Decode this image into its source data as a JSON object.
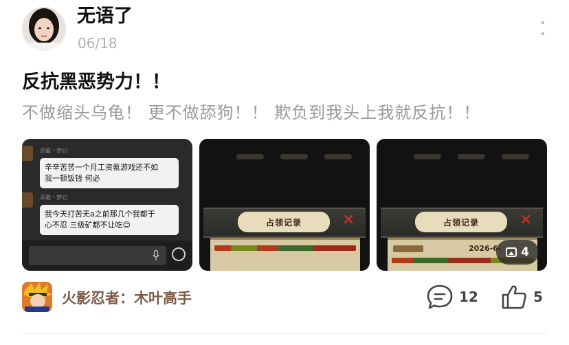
{
  "post": {
    "author": "无语了",
    "date": "06/18",
    "title": "反抗黑恶势力！！",
    "body": "不做缩头乌龟！ 更不做舔狗！！ 欺负到我头上我就反抗！！"
  },
  "images": {
    "chat": {
      "sender_name": "恶霸丶梦幻",
      "msg1_line1": "辛辛苦苦一个月工资氪游戏还不如",
      "msg1_line2": "我一顿饭钱 何必",
      "msg2_line1": "我今天打苦无a之前那几个我都于",
      "msg2_line2": "心不忍 三级矿都不让吃😊"
    },
    "game1": {
      "panel_title": "占领记录"
    },
    "game2": {
      "panel_title": "占领记录",
      "date_text": "2026-6-"
    },
    "more_count": "4"
  },
  "footer": {
    "game_tag": "火影忍者：木叶高手",
    "comment_count": "12",
    "like_count": "5"
  },
  "icons": [
    "more-icon",
    "photos-icon",
    "comment-icon",
    "like-icon",
    "mic-icon",
    "emoji-icon",
    "close-icon"
  ],
  "colors": {
    "accent_brown": "#7c5b47",
    "muted": "#9a9a9a",
    "game_red": "#d43222"
  }
}
